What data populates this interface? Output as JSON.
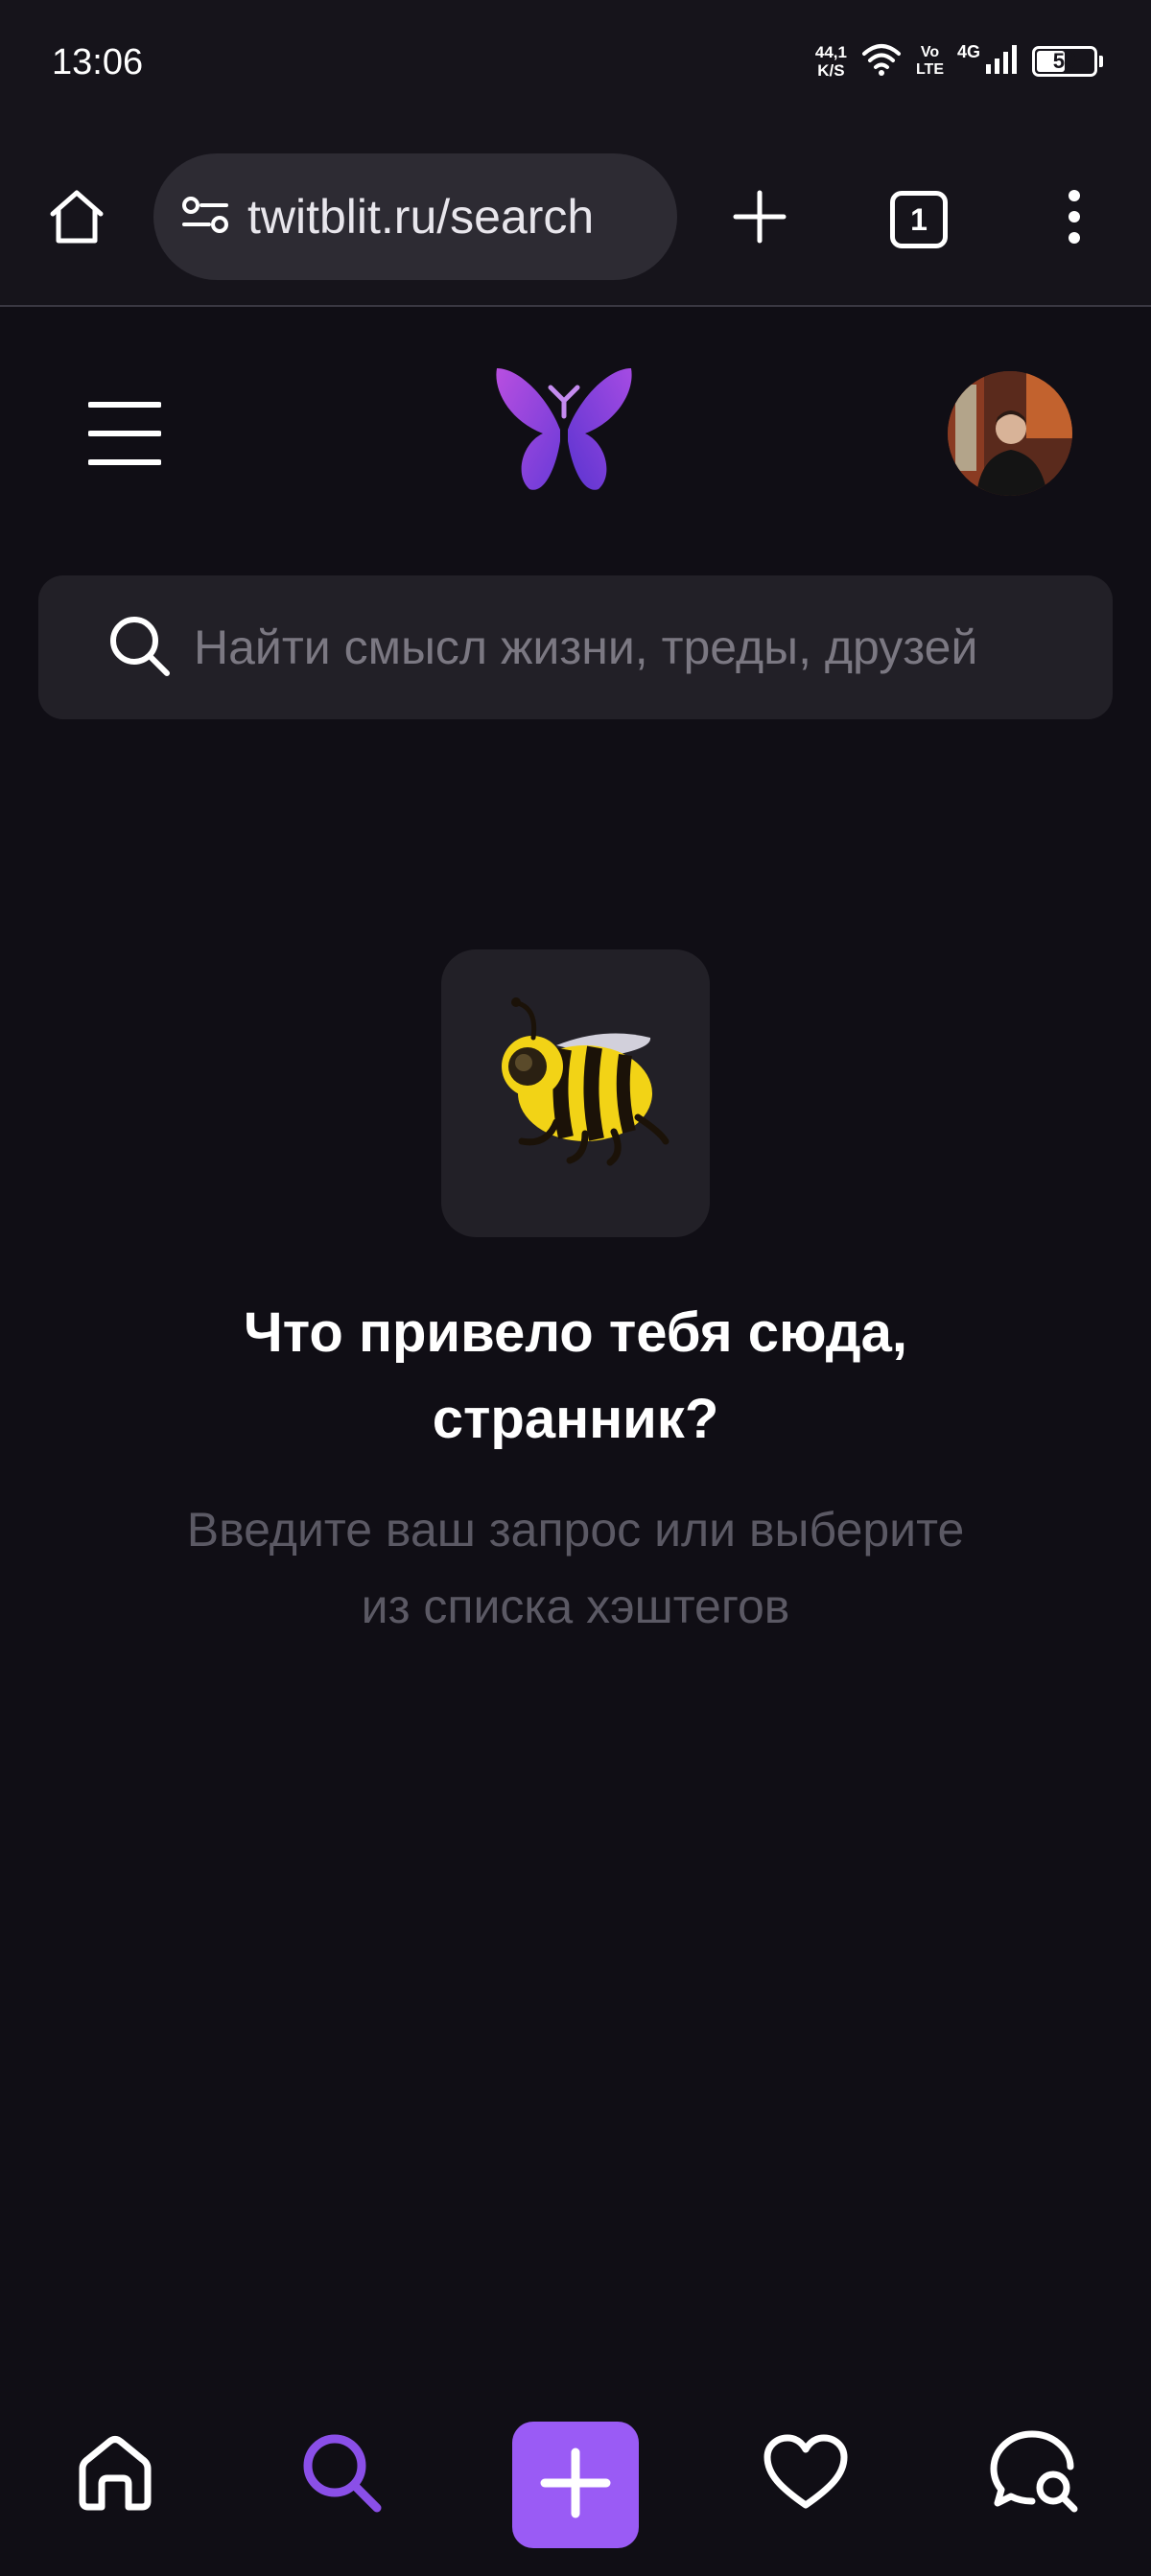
{
  "status_bar": {
    "time": "13:06",
    "net_speed_value": "44,1",
    "net_speed_unit": "K/S",
    "volte_top": "Vo",
    "volte_bottom": "LTE",
    "network_type": "4G",
    "battery_level": "50",
    "battery_fraction": 0.5
  },
  "browser": {
    "url": "twitblit.ru/search",
    "tab_count": "1",
    "icons": {
      "home": "home-icon",
      "site_settings": "site-settings-icon",
      "new_tab": "plus-icon",
      "menu": "more-vert-icon"
    }
  },
  "header": {
    "menu_icon": "hamburger-icon",
    "logo_icon": "butterfly-logo",
    "avatar_icon": "user-avatar"
  },
  "search": {
    "placeholder": "Найти смысл жизни, треды, друзей",
    "value": "",
    "icon": "search-icon"
  },
  "empty_state": {
    "image": "bee-icon",
    "title_line1": "Что привело тебя сюда,",
    "title_line2": "странник?",
    "subtitle_line1": "Введите ваш запрос или выберите",
    "subtitle_line2": "из списка хэштегов"
  },
  "bottom_nav": {
    "active": "search",
    "items": [
      "home-icon",
      "search-icon",
      "plus-icon",
      "heart-icon",
      "chat-search-icon"
    ]
  },
  "colors": {
    "background": "#100e15",
    "surface": "#222027",
    "accent": "#9a5bf5",
    "accent_icon": "#8a4fe8",
    "muted_text": "#5b5964",
    "placeholder_text": "#7b7882"
  }
}
